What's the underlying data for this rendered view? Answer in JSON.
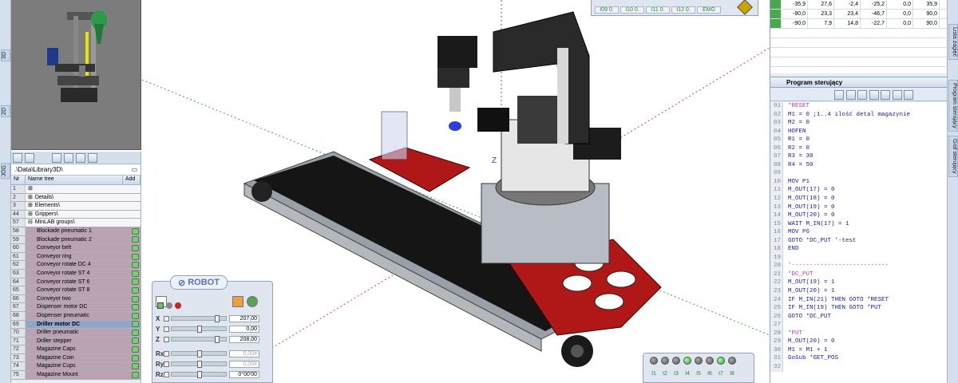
{
  "left_tabs": [
    "3D",
    "2D",
    "JOG"
  ],
  "library": {
    "path": ".\\Data\\Library3D\\",
    "columns": {
      "nr": "Nr",
      "name": "Name tree",
      "add": "Add"
    },
    "rows": [
      {
        "nr": "1",
        "name": "",
        "type": "group",
        "prefix": "⊞"
      },
      {
        "nr": "2",
        "name": "Details\\",
        "type": "group",
        "prefix": "⊞"
      },
      {
        "nr": "3",
        "name": "Elements\\",
        "type": "group",
        "prefix": "⊞"
      },
      {
        "nr": "44",
        "name": "Grippers\\",
        "type": "group",
        "prefix": "⊞"
      },
      {
        "nr": "57",
        "name": "MinLAB groups\\",
        "type": "group",
        "prefix": "⊟"
      },
      {
        "nr": "58",
        "name": "Blockade pneumatic 1",
        "type": "item"
      },
      {
        "nr": "59",
        "name": "Blockade pneumatic 2",
        "type": "item"
      },
      {
        "nr": "60",
        "name": "Conveyor belt",
        "type": "item"
      },
      {
        "nr": "61",
        "name": "Conveyor ring",
        "type": "item"
      },
      {
        "nr": "62",
        "name": "Conveyor rotate DC 4",
        "type": "item"
      },
      {
        "nr": "63",
        "name": "Conveyor rotate ST 4",
        "type": "item"
      },
      {
        "nr": "64",
        "name": "Conveyor rotate ST 6",
        "type": "item"
      },
      {
        "nr": "65",
        "name": "Conveyor rotate ST 8",
        "type": "item"
      },
      {
        "nr": "66",
        "name": "Conveyor two",
        "type": "item"
      },
      {
        "nr": "67",
        "name": "Dispenser motor DC",
        "type": "item"
      },
      {
        "nr": "68",
        "name": "Dispenser pneumatic",
        "type": "item"
      },
      {
        "nr": "69",
        "name": "Driller motor DC",
        "type": "sel"
      },
      {
        "nr": "70",
        "name": "Driller pneumatic",
        "type": "item"
      },
      {
        "nr": "71",
        "name": "Driller stepper",
        "type": "item"
      },
      {
        "nr": "72",
        "name": "Magazine Caps",
        "type": "item"
      },
      {
        "nr": "73",
        "name": "Magazine Coin",
        "type": "item"
      },
      {
        "nr": "74",
        "name": "Magazine Cups",
        "type": "item"
      },
      {
        "nr": "75",
        "name": "Magazine Mount",
        "type": "item"
      }
    ]
  },
  "robot_panel": {
    "title": "ROBOT",
    "coords": [
      {
        "label": "X",
        "value": "207,00",
        "level": 0.85,
        "disabled": false
      },
      {
        "label": "Y",
        "value": "0,00",
        "level": 0.5,
        "disabled": false
      },
      {
        "label": "Z",
        "value": "208,00",
        "level": 0.85,
        "disabled": false
      },
      {
        "label": "Rx",
        "value": "0,00#",
        "level": 0.5,
        "disabled": true
      },
      {
        "label": "Ry",
        "value": "0,00#",
        "level": 0.5,
        "disabled": true
      },
      {
        "label": "Rz",
        "value": "0°00'00",
        "level": 0.5,
        "disabled": false
      }
    ]
  },
  "io_top": {
    "labels": [
      "I09 0.",
      "I10 0.",
      "I11 0.",
      "I12 0.",
      "EMG"
    ]
  },
  "io_bottom": {
    "labels": [
      "I1",
      "I2",
      "I3",
      "I4",
      "I5",
      "I6",
      "I7",
      "I8"
    ],
    "states": [
      0,
      0,
      0,
      1,
      0,
      0,
      1,
      0
    ]
  },
  "vars_table": [
    [
      "-35,9",
      "27,6",
      "-2,4",
      "-25,2",
      "0,0",
      "35,9"
    ],
    [
      "-90,0",
      "23,3",
      "23,4",
      "-46,7",
      "0,0",
      "90,0"
    ],
    [
      "-90,0",
      "7,9",
      "14,8",
      "-22,7",
      "0,0",
      "90,0"
    ]
  ],
  "program": {
    "title": "Program sterujący",
    "lines": [
      "*RESET",
      "M1 = 0  ;1..4 ilość detal magazynie",
      "M2 = 0",
      "HOFEN",
      "R1 = 0",
      "R2 = 0",
      "R3 = 30",
      "R4 = 50",
      "",
      "MOV P1",
      "M_OUT(17) = 0",
      "M_OUT(18) = 0",
      "M_OUT(19) = 0",
      "M_OUT(20) = 0",
      "WAIT M_IN(17) = 1",
      "MOV P6",
      "GOTO *DC_PUT '-test",
      "END",
      "",
      "'---------------------------",
      "*DC_PUT",
      "M_OUT(19) = 1",
      "M_OUT(20) = 1",
      "IF M_IN(21) THEN GOTO *RESET",
      "IF M_IN(19) THEN GOTO *PUT",
      "GOTO *DC_PUT",
      "",
      "*PUT",
      "M_OUT(20) = 0",
      "M1 = M1 + 1",
      "GoSub *GET_POS",
      ""
    ]
  },
  "right_tabs": [
    "Lista zagięć",
    "Program sterujący",
    "Graf sterujący"
  ],
  "colors": {
    "accent": "#5a6fc7",
    "selected": "#8fa7cc",
    "item": "#b9a3b3"
  }
}
